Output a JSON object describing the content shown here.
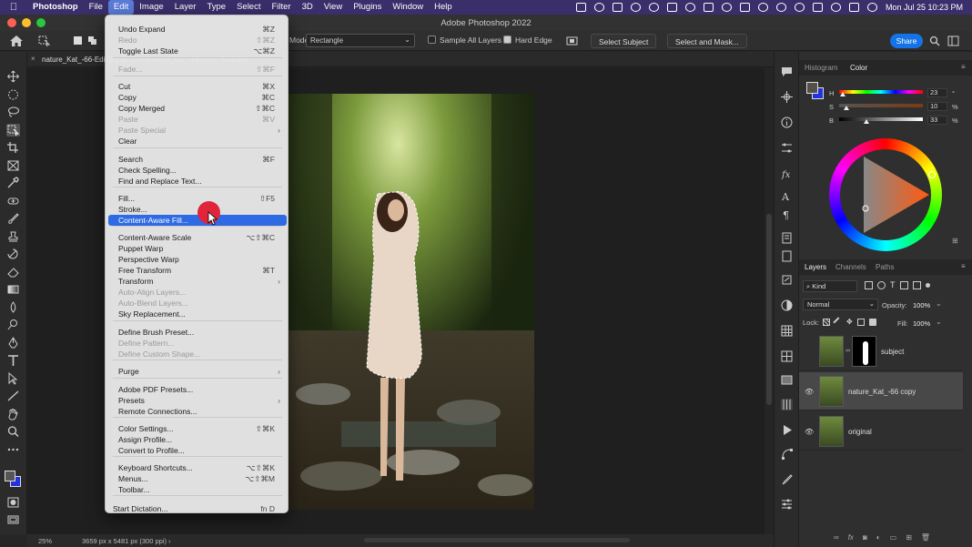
{
  "menubar": {
    "app_name": "Photoshop",
    "items": [
      "File",
      "Edit",
      "Image",
      "Layer",
      "Type",
      "Select",
      "Filter",
      "3D",
      "View",
      "Plugins",
      "Window",
      "Help"
    ],
    "datetime": "Mon Jul 25  10:23 PM"
  },
  "window": {
    "title": "Adobe Photoshop 2022"
  },
  "options": {
    "mode_label": "Mode:",
    "mode_value": "Rectangle",
    "sample_all_layers": "Sample All Layers",
    "hard_edge": "Hard Edge",
    "select_subject": "Select Subject",
    "select_and_mask": "Select and Mask...",
    "share": "Share"
  },
  "document": {
    "tab_title": "nature_Kat_-66-Edit.jpg @ 25% (nature_Kat_-66 copy, RGB/8#)",
    "zoom": "25%",
    "dimensions": "3659 px x 5481 px (300 ppi)"
  },
  "edit_menu": {
    "items": [
      {
        "label": "Undo Expand",
        "shortcut": "⌘Z",
        "disabled": false
      },
      {
        "label": "Redo",
        "shortcut": "⇧⌘Z",
        "disabled": true
      },
      {
        "label": "Toggle Last State",
        "shortcut": "⌥⌘Z",
        "disabled": false
      },
      {
        "label": "Fade...",
        "shortcut": "⇧⌘F",
        "disabled": true
      },
      {
        "label": "Cut",
        "shortcut": "⌘X",
        "disabled": false
      },
      {
        "label": "Copy",
        "shortcut": "⌘C",
        "disabled": false
      },
      {
        "label": "Copy Merged",
        "shortcut": "⇧⌘C",
        "disabled": false
      },
      {
        "label": "Paste",
        "shortcut": "⌘V",
        "disabled": true
      },
      {
        "label": "Paste Special",
        "shortcut": "",
        "disabled": true
      },
      {
        "label": "Clear",
        "shortcut": "",
        "disabled": false
      },
      {
        "label": "Search",
        "shortcut": "⌘F",
        "disabled": false
      },
      {
        "label": "Check Spelling...",
        "shortcut": "",
        "disabled": false
      },
      {
        "label": "Find and Replace Text...",
        "shortcut": "",
        "disabled": false
      },
      {
        "label": "Fill...",
        "shortcut": "⇧F5",
        "disabled": false
      },
      {
        "label": "Stroke...",
        "shortcut": "",
        "disabled": false
      },
      {
        "label": "Content-Aware Fill...",
        "shortcut": "",
        "disabled": false
      },
      {
        "label": "Content-Aware Scale",
        "shortcut": "⌥⇧⌘C",
        "disabled": false
      },
      {
        "label": "Puppet Warp",
        "shortcut": "",
        "disabled": false
      },
      {
        "label": "Perspective Warp",
        "shortcut": "",
        "disabled": false
      },
      {
        "label": "Free Transform",
        "shortcut": "⌘T",
        "disabled": false
      },
      {
        "label": "Transform",
        "shortcut": "",
        "disabled": false
      },
      {
        "label": "Auto-Align Layers...",
        "shortcut": "",
        "disabled": true
      },
      {
        "label": "Auto-Blend Layers...",
        "shortcut": "",
        "disabled": true
      },
      {
        "label": "Sky Replacement...",
        "shortcut": "",
        "disabled": false
      },
      {
        "label": "Define Brush Preset...",
        "shortcut": "",
        "disabled": false
      },
      {
        "label": "Define Pattern...",
        "shortcut": "",
        "disabled": true
      },
      {
        "label": "Define Custom Shape...",
        "shortcut": "",
        "disabled": true
      },
      {
        "label": "Purge",
        "shortcut": "",
        "disabled": false
      },
      {
        "label": "Adobe PDF Presets...",
        "shortcut": "",
        "disabled": false
      },
      {
        "label": "Presets",
        "shortcut": "",
        "disabled": false
      },
      {
        "label": "Remote Connections...",
        "shortcut": "",
        "disabled": false
      },
      {
        "label": "Color Settings...",
        "shortcut": "⇧⌘K",
        "disabled": false
      },
      {
        "label": "Assign Profile...",
        "shortcut": "",
        "disabled": false
      },
      {
        "label": "Convert to Profile...",
        "shortcut": "",
        "disabled": false
      },
      {
        "label": "Keyboard Shortcuts...",
        "shortcut": "⌥⇧⌘K",
        "disabled": false
      },
      {
        "label": "Menus...",
        "shortcut": "⌥⇧⌘M",
        "disabled": false
      },
      {
        "label": "Toolbar...",
        "shortcut": "",
        "disabled": false
      },
      {
        "label": "Start Dictation...",
        "shortcut": "fn D",
        "disabled": false
      }
    ]
  },
  "color_panel": {
    "tabs": [
      "Histogram",
      "Color"
    ],
    "h_label": "H",
    "h_value": "23",
    "h_unit": "°",
    "s_label": "S",
    "s_value": "10",
    "s_unit": "%",
    "b_label": "B",
    "b_value": "33",
    "b_unit": "%"
  },
  "layers_panel": {
    "tabs": [
      "Layers",
      "Channels",
      "Paths"
    ],
    "kind": "Kind",
    "blend_mode": "Normal",
    "opacity_label": "Opacity:",
    "opacity_value": "100%",
    "lock_label": "Lock:",
    "fill_label": "Fill:",
    "fill_value": "100%",
    "layers": [
      {
        "name": "subject"
      },
      {
        "name": "nature_Kat_-66 copy"
      },
      {
        "name": "original"
      }
    ]
  },
  "colors": {
    "menubar": "#3a2f6b",
    "highlight": "#2d6ae3",
    "share": "#1473e6"
  }
}
